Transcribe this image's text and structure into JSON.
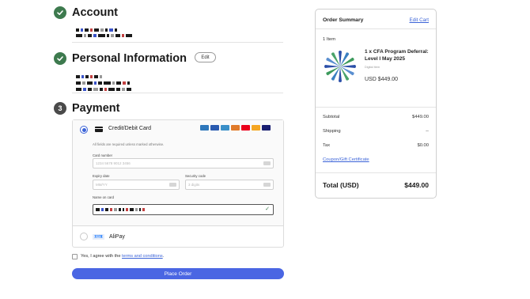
{
  "steps": {
    "account": {
      "title": "Account"
    },
    "personal": {
      "title": "Personal Information",
      "edit_label": "Edit"
    },
    "payment": {
      "number": "3",
      "title": "Payment"
    }
  },
  "payment": {
    "credit_card": {
      "label": "Credit/Debit Card",
      "required_note": "All fields are required unless marked otherwise.",
      "card_number_label": "Card number",
      "card_number_placeholder": "1234 5678 9012 3456",
      "expiry_label": "Expiry date",
      "expiry_placeholder": "MM/YY",
      "security_label": "Security code",
      "security_placeholder": "3 digits",
      "name_label": "Name on card",
      "brands": [
        {
          "name": "amex",
          "color": "#2e77bb"
        },
        {
          "name": "amex",
          "color": "#2a5bb0"
        },
        {
          "name": "diners",
          "color": "#3a8fc8"
        },
        {
          "name": "discover",
          "color": "#e07a2a"
        },
        {
          "name": "mastercard",
          "color": "#eb001b"
        },
        {
          "name": "maestro",
          "color": "#f5a623"
        },
        {
          "name": "visa",
          "color": "#1a1f71"
        }
      ]
    },
    "alipay": {
      "label": "AliPay",
      "logo_text": "支付宝"
    }
  },
  "agreement": {
    "prefix": "Yes, I agree with the ",
    "link": "terms and conditions",
    "suffix": "."
  },
  "place_order": "Place Order",
  "summary": {
    "title": "Order Summary",
    "edit_cart": "Edit Cart",
    "item_count": "1 Item",
    "product": {
      "name": "1 x CFA Program Deferral: Level I May 2025",
      "type": "Digital Item",
      "price": "USD $449.00"
    },
    "subtotal_label": "Subtotal",
    "subtotal_value": "$449.00",
    "shipping_label": "Shipping",
    "shipping_value": "--",
    "tax_label": "Tax",
    "tax_value": "$0.00",
    "coupon": "Coupon/Gift Certificate",
    "total_label": "Total (USD)",
    "total_value": "$449.00"
  },
  "colors": {
    "accent": "#4a66e3",
    "link": "#3c64d8",
    "success": "#3d7a4e"
  }
}
